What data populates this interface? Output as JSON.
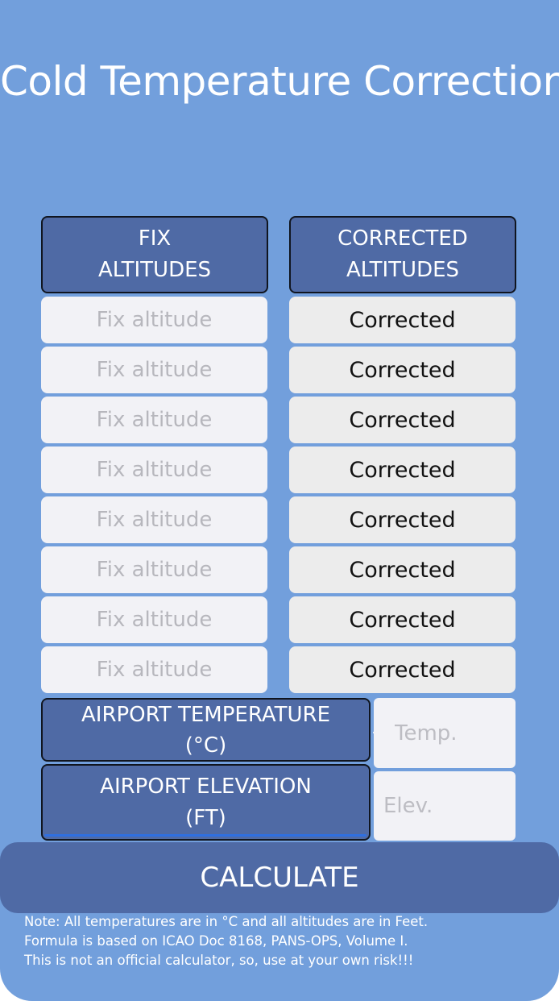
{
  "title": "Cold Temperature Correction",
  "headers": {
    "fix": "FIX\nALTITUDES",
    "corrected": "CORRECTED\nALTITUDES"
  },
  "rows": [
    {
      "fix_placeholder": "Fix altitude",
      "fix_value": "",
      "corrected": "Corrected"
    },
    {
      "fix_placeholder": "Fix altitude",
      "fix_value": "",
      "corrected": "Corrected"
    },
    {
      "fix_placeholder": "Fix altitude",
      "fix_value": "",
      "corrected": "Corrected"
    },
    {
      "fix_placeholder": "Fix altitude",
      "fix_value": "",
      "corrected": "Corrected"
    },
    {
      "fix_placeholder": "Fix altitude",
      "fix_value": "",
      "corrected": "Corrected"
    },
    {
      "fix_placeholder": "Fix altitude",
      "fix_value": "",
      "corrected": "Corrected"
    },
    {
      "fix_placeholder": "Fix altitude",
      "fix_value": "",
      "corrected": "Corrected"
    },
    {
      "fix_placeholder": "Fix altitude",
      "fix_value": "",
      "corrected": "Corrected"
    }
  ],
  "temperature": {
    "label": "AIRPORT TEMPERATURE\n(°C)",
    "sign": "-",
    "placeholder": "Temp.",
    "value": ""
  },
  "elevation": {
    "label": "AIRPORT ELEVATION\n(FT)",
    "placeholder": "Elev.",
    "value": ""
  },
  "calculate_label": "CALCULATE",
  "note": [
    "Note: All temperatures are in °C and all altitudes are in Feet.",
    "Formula is based on ICAO Doc 8168, PANS-OPS, Volume I.",
    "This is not an official calculator, so, use at your own risk!!!"
  ],
  "colors": {
    "background": "#729fdc",
    "header": "#4f6aa5",
    "input": "#f2f2f6",
    "output": "#ececec"
  }
}
